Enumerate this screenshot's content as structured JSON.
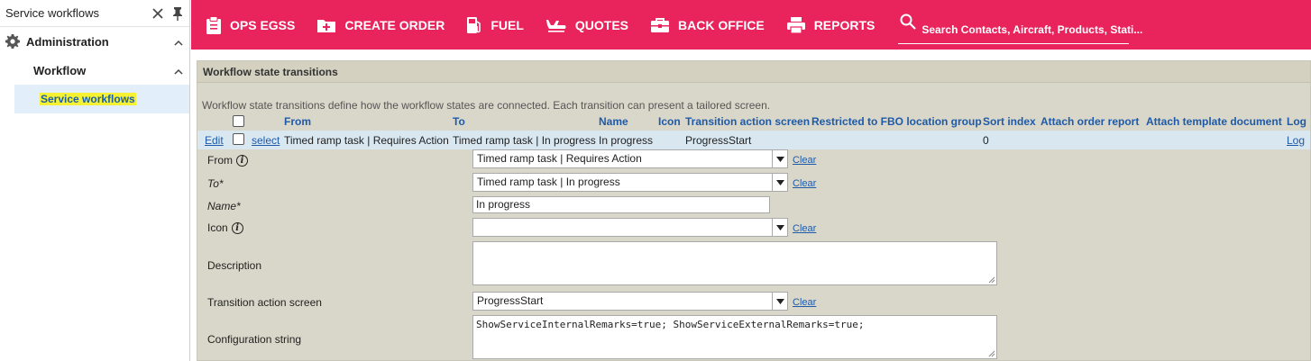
{
  "sidebar": {
    "title": "Service workflows",
    "close_icon": "close-icon",
    "pin_icon": "pin-icon",
    "section": {
      "label": "Administration",
      "icon": "gear-icon"
    },
    "group": {
      "label": "Workflow"
    },
    "active_item": {
      "label": "Service workflows"
    }
  },
  "topbar": {
    "items": [
      {
        "label": "OPS EGSS",
        "icon": "clipboard-icon"
      },
      {
        "label": "CREATE ORDER",
        "icon": "add-order-icon"
      },
      {
        "label": "FUEL",
        "icon": "fuel-pump-icon"
      },
      {
        "label": "QUOTES",
        "icon": "airplane-icon"
      },
      {
        "label": "BACK OFFICE",
        "icon": "briefcase-icon"
      },
      {
        "label": "REPORTS",
        "icon": "printer-icon"
      }
    ],
    "search_placeholder": "Search Contacts, Aircraft, Products, Stati..."
  },
  "panel": {
    "title": "Workflow state transitions",
    "description": "Workflow state transitions define how the workflow states are connected. Each transition can present a tailored screen."
  },
  "grid": {
    "headers": {
      "from": "From",
      "to": "To",
      "name": "Name",
      "icon": "Icon",
      "transition_screen": "Transition action screen",
      "restricted": "Restricted to FBO location group",
      "sort_index": "Sort index",
      "attach_report": "Attach order report",
      "attach_template": "Attach template document",
      "log": "Log"
    },
    "row": {
      "edit": "Edit",
      "select": "select",
      "from": "Timed ramp task | Requires Action",
      "to": "Timed ramp task | In progress",
      "name": "In progress",
      "transition_screen": "ProgressStart",
      "sort_index": "0",
      "log": "Log"
    }
  },
  "form": {
    "from": {
      "label": "From",
      "value": "Timed ramp task | Requires Action",
      "clear": "Clear"
    },
    "to": {
      "label": "To*",
      "value": "Timed ramp task | In progress",
      "clear": "Clear"
    },
    "name": {
      "label": "Name*",
      "value": "In progress"
    },
    "icon": {
      "label": "Icon",
      "value": "",
      "clear": "Clear"
    },
    "description": {
      "label": "Description",
      "value": ""
    },
    "transition_screen": {
      "label": "Transition action screen",
      "value": "ProgressStart",
      "clear": "Clear"
    },
    "config": {
      "label": "Configuration string",
      "value": "ShowServiceInternalRemarks=true; ShowServiceExternalRemarks=true;"
    }
  },
  "colors": {
    "brand": "#e9235c",
    "panel_bg": "#d9d7c9",
    "row_highlight": "#d9e7f1",
    "link": "#1f5aa8",
    "active_highlight": "#f6f233"
  }
}
